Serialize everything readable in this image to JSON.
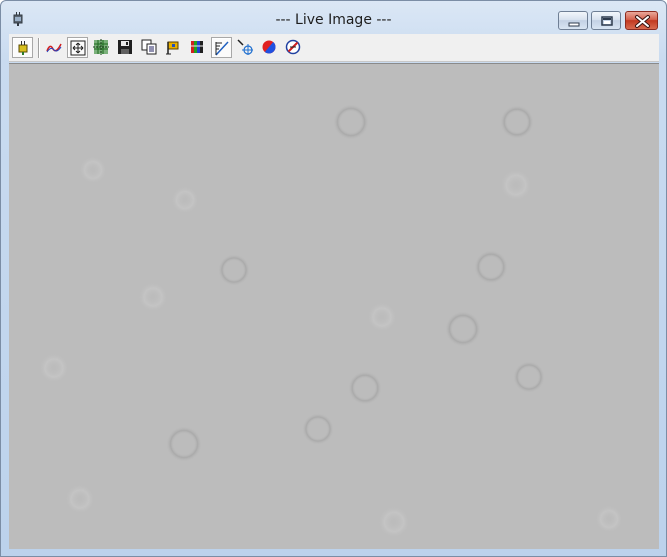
{
  "window": {
    "title": "--- Live Image ---",
    "app_icon": "camera-connector-icon",
    "controls": [
      "minimize-icon",
      "maximize-icon",
      "close-icon"
    ]
  },
  "toolbar": {
    "buttons": [
      {
        "icon": "live-camera-icon",
        "pressed": true
      },
      {
        "icon": "histogram-curve-icon",
        "pressed": false
      },
      {
        "icon": "fit-to-window-icon",
        "pressed": true
      },
      {
        "icon": "crosshair-grid-icon",
        "pressed": false
      },
      {
        "icon": "save-disk-icon",
        "pressed": false
      },
      {
        "icon": "copy-icon",
        "pressed": false
      },
      {
        "icon": "color-flag-icon",
        "pressed": false
      },
      {
        "icon": "color-bars-icon",
        "pressed": false
      },
      {
        "icon": "measure-line-icon",
        "pressed": true
      },
      {
        "icon": "target-pointer-icon",
        "pressed": false
      },
      {
        "icon": "color-circle-icon",
        "pressed": false
      },
      {
        "icon": "no-entry-icon",
        "pressed": false
      }
    ]
  },
  "colors": {
    "frame": "#c9dbf0",
    "toolbar": "#f0f0f0",
    "image_background": "#bcbcbc",
    "close_button": "#c2381f"
  }
}
